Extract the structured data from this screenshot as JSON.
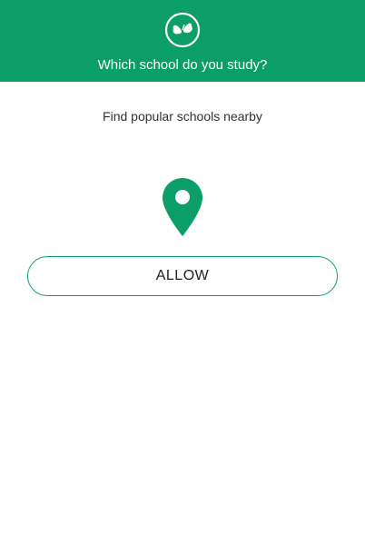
{
  "header": {
    "logo_icon": "butterfly-logo-icon",
    "title": "Which school do you study?"
  },
  "main": {
    "subtitle": "Find popular schools nearby",
    "location_icon": "location-pin-icon",
    "allow_label": "ALLOW"
  },
  "colors": {
    "brand": "#0b9e68",
    "text": "#333333",
    "background": "#ffffff"
  }
}
